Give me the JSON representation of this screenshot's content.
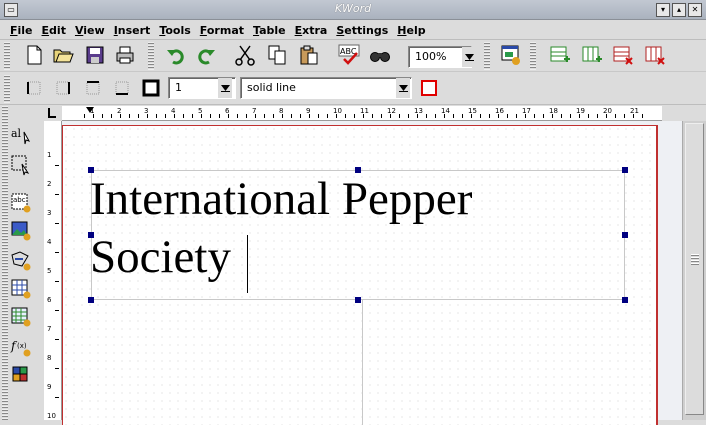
{
  "window": {
    "title": "KWord"
  },
  "menubar": {
    "items": [
      "File",
      "Edit",
      "View",
      "Insert",
      "Tools",
      "Format",
      "Table",
      "Extra",
      "Settings",
      "Help"
    ]
  },
  "toolbar": {
    "zoom_value": "100%",
    "border_width_value": "1",
    "border_style_value": "solid line"
  },
  "ruler": {
    "h_labels": [
      "1",
      "2",
      "3",
      "4",
      "5",
      "6",
      "7",
      "8",
      "9",
      "10",
      "11",
      "12",
      "13",
      "14",
      "15",
      "16",
      "17",
      "18",
      "19",
      "20",
      "21"
    ],
    "v_labels": [
      "1",
      "2",
      "3",
      "4",
      "5",
      "6",
      "7",
      "8",
      "9",
      "10"
    ]
  },
  "document": {
    "line1": "International Pepper",
    "line2": "Society"
  },
  "icons": [
    "new-icon",
    "open-icon",
    "save-icon",
    "print-icon",
    "undo-icon",
    "redo-icon",
    "cut-icon",
    "copy-icon",
    "paste-icon",
    "spellcheck-icon",
    "find-icon",
    "frame-icon",
    "table-insert-row-icon",
    "table-insert-col-icon",
    "table-delete-row-icon",
    "table-delete-col-icon",
    "border-left-icon",
    "border-right-icon",
    "border-top-icon",
    "border-bottom-icon",
    "border-color-icon"
  ],
  "colors": {
    "frame_handle": "#000080",
    "page_border": "#c03030",
    "border_color_swatch": "#e00000"
  }
}
